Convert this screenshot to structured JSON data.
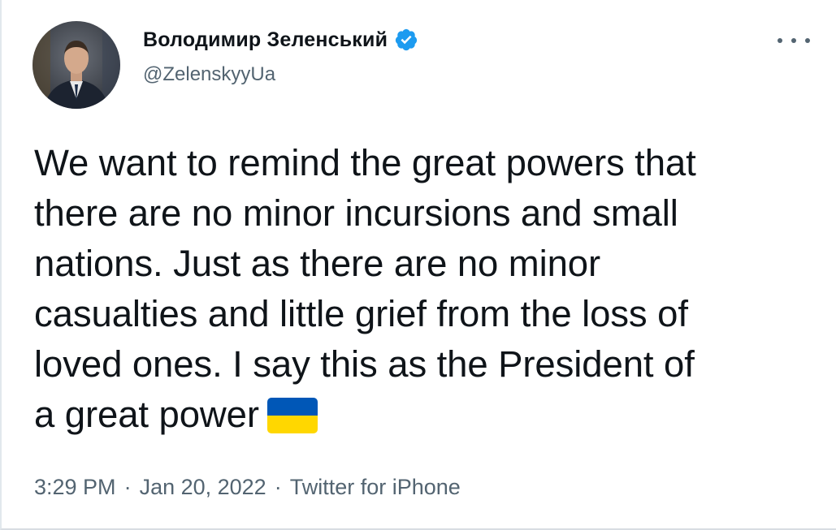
{
  "tweet": {
    "display_name": "Володимир Зеленський",
    "handle": "@ZelenskyyUa",
    "text_lines": [
      "We want to remind the great powers that",
      "there are no minor incursions and small",
      "nations. Just as there are no minor",
      "casualties and little grief from the loss of",
      "loved ones. I say this as the President of",
      "a great power"
    ],
    "time": "3:29 PM",
    "date": "Jan 20, 2022",
    "source": "Twitter for iPhone",
    "separator": "·"
  },
  "icons": {
    "verified": "verified-badge-icon",
    "more": "more-options-icon",
    "flag": "ukraine-flag-icon"
  },
  "colors": {
    "verified_blue": "#1d9bf0",
    "meta_gray": "#536471",
    "flag_blue": "#0057b7",
    "flag_yellow": "#ffd700"
  }
}
